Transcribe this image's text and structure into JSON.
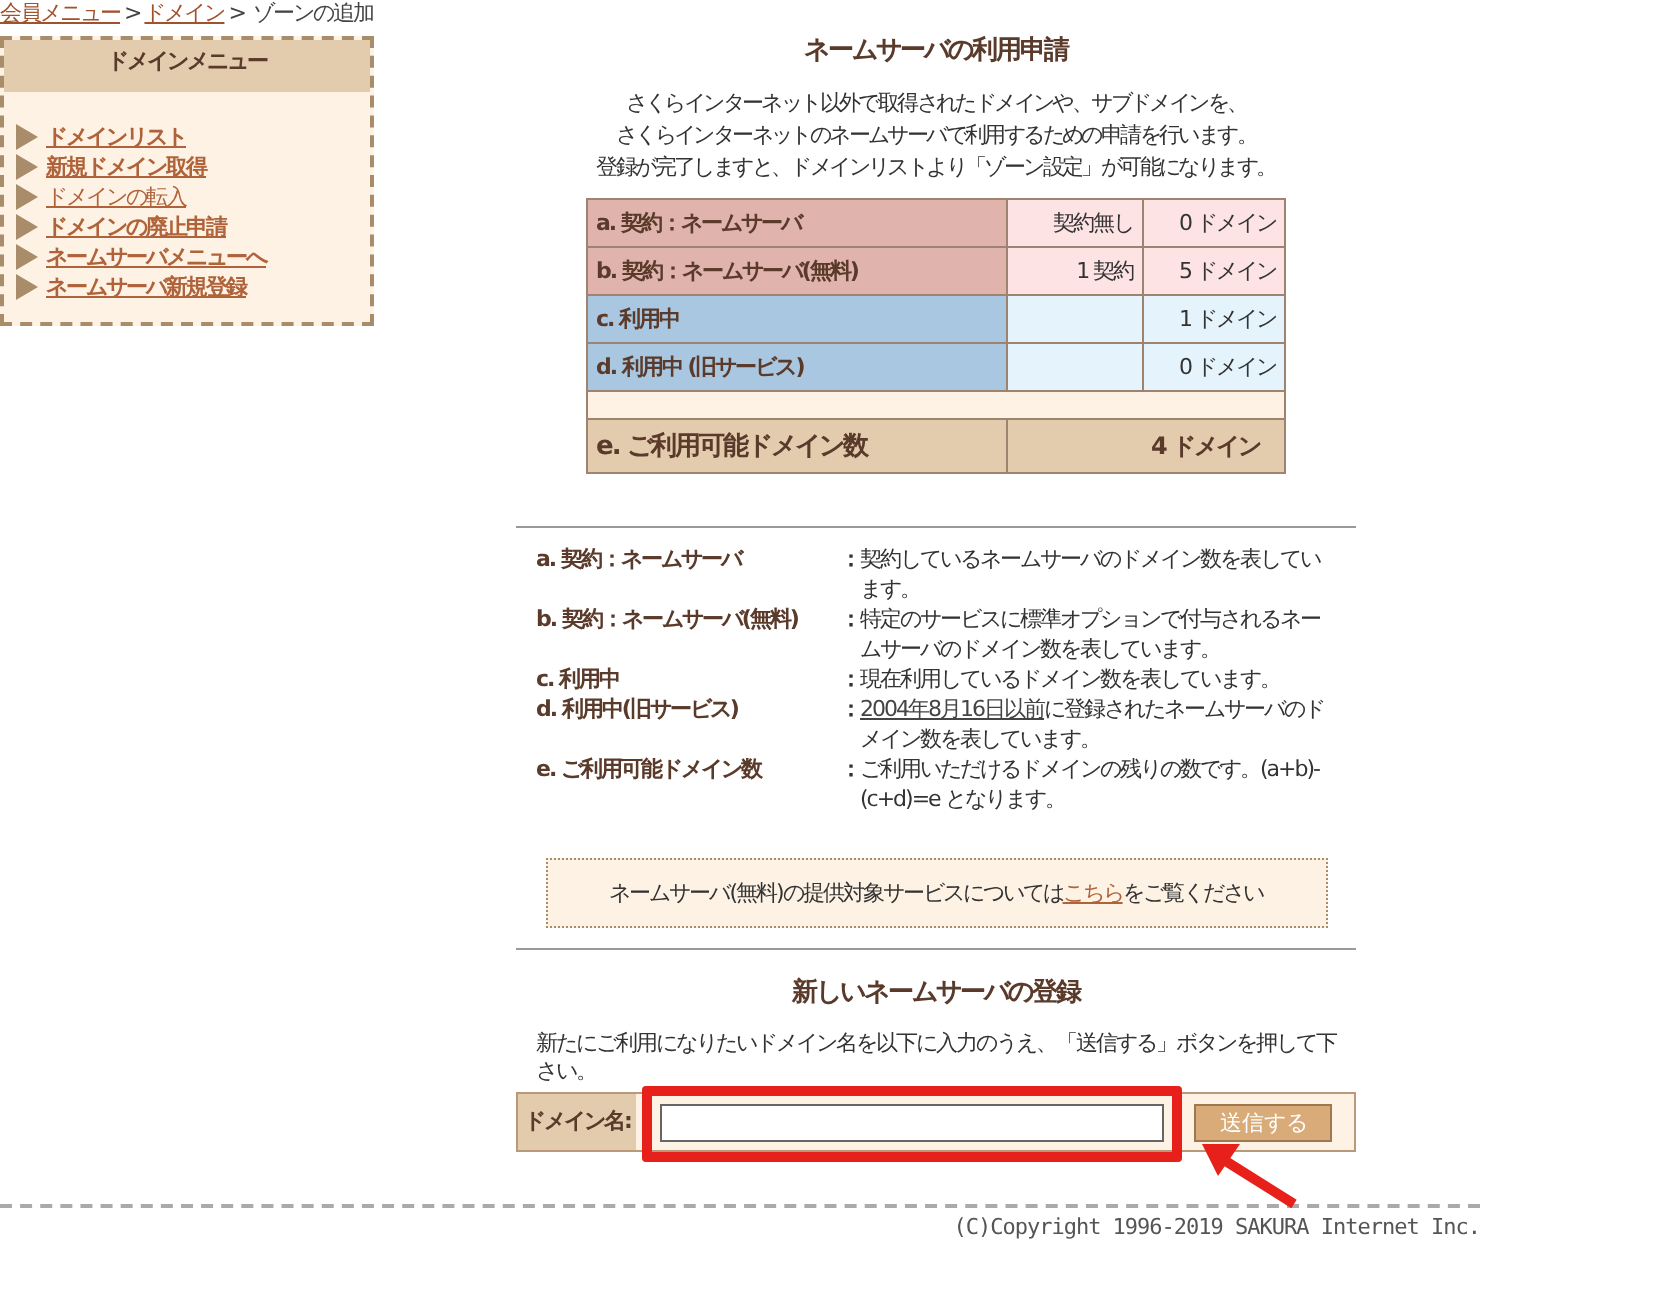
{
  "breadcrumb": [
    {
      "label": "会員メニュー",
      "link": true
    },
    {
      "label": "ドメイン",
      "link": true
    },
    {
      "label": "ゾーンの追加",
      "link": false
    }
  ],
  "breadcrumb_separator": ">",
  "sidebar": {
    "title": "ドメインメニュー",
    "items": [
      {
        "label": "ドメインリスト",
        "bold": true
      },
      {
        "label": "新規ドメイン取得",
        "bold": true
      },
      {
        "label": "ドメインの転入",
        "bold": false
      },
      {
        "label": "ドメインの廃止申請",
        "bold": true
      },
      {
        "label": "ネームサーバメニューへ",
        "bold": true
      },
      {
        "label": "ネームサーバ新規登録",
        "bold": true
      }
    ]
  },
  "title": "ネームサーバの利用申請",
  "intro": [
    "さくらインターネット以外で取得されたドメインや、サブドメインを、",
    "さくらインターネットのネームサーバで利用するための申請を行います。",
    "登録が完了しますと、ドメインリストより「ゾーン設定」が可能になります。"
  ],
  "summary_table": {
    "rows": [
      {
        "kind": "contract",
        "label": "a. 契約：ネームサーバ",
        "column_2": "契約無し",
        "column_3": "0 ドメイン"
      },
      {
        "kind": "contract",
        "label": "b. 契約：ネームサーバ(無料)",
        "column_2": "1 契約",
        "column_3": "5 ドメイン"
      },
      {
        "kind": "usage",
        "label": "c. 利用中",
        "column_3": "1 ドメイン"
      },
      {
        "kind": "usage",
        "label": "d. 利用中 (旧サービス)",
        "column_3": "0 ドメイン"
      },
      {
        "kind": "spacer"
      },
      {
        "kind": "total",
        "label": "e. ご利用可能ドメイン数",
        "column_2": "4 ドメイン"
      }
    ]
  },
  "definitions": [
    {
      "term": "a. 契約：ネームサーバ",
      "description": "契約しているネームサーバのドメイン数を表しています。"
    },
    {
      "term": "b. 契約：ネームサーバ(無料)",
      "description": "特定のサービスに標準オプションで付与されるネームサーバのドメイン数を表しています。"
    },
    {
      "term": "c. 利用中",
      "description": "現在利用しているドメイン数を表しています。"
    },
    {
      "term": "d. 利用中(旧サービス)",
      "link": "2004年8月16日以前",
      "description": "に登録されたネームサーバのドメイン数を表しています。"
    },
    {
      "term": "e. ご利用可能ドメイン数",
      "description": "ご利用いただけるドメインの残りの数です。(a+b)-(c+d)=e となります。"
    }
  ],
  "definition_separator": "：",
  "notice": {
    "before": "ネームサーバ(無料)の提供対象サービスについては",
    "link": "こちら",
    "after": "をご覧ください"
  },
  "register": {
    "heading": "新しいネームサーバの登録",
    "instruction": "新たにご利用になりたいドメイン名を以下に入力のうえ、「送信する」ボタンを押して下さい。",
    "field_label": "ドメイン名:",
    "highlighted": true,
    "button": "送信する"
  },
  "footer": "(C)Copyright 1996-2019 SAKURA Internet Inc."
}
